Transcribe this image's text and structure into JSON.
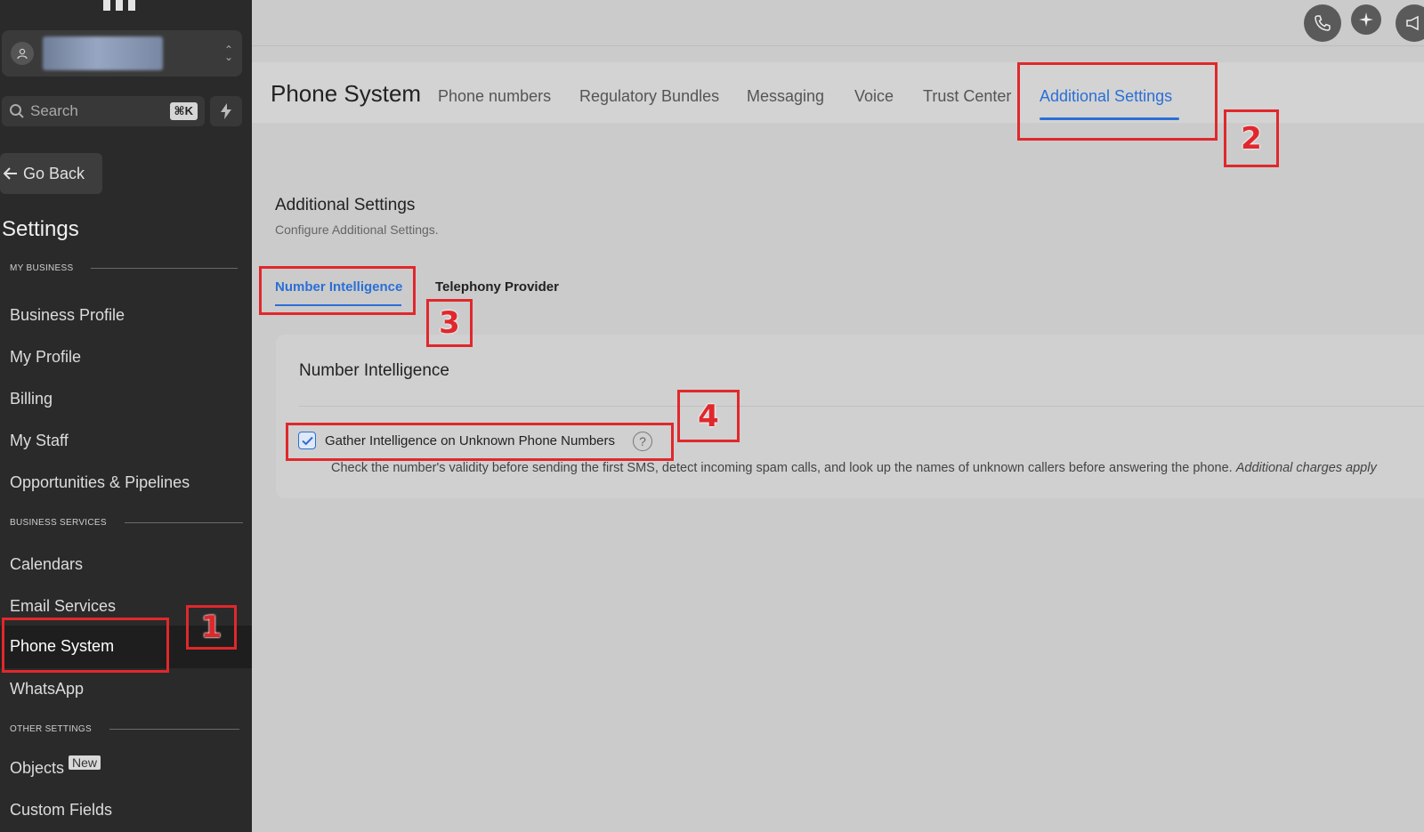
{
  "sidebar": {
    "account_icon": "user-circle-icon",
    "search": {
      "placeholder": "Search",
      "shortcut": "⌘K"
    },
    "go_back_label": "Go Back",
    "settings_heading": "Settings",
    "sections": {
      "my_business": "MY BUSINESS",
      "business_services": "BUSINESS SERVICES",
      "other_settings": "OTHER SETTINGS"
    },
    "items": {
      "business_profile": "Business Profile",
      "my_profile": "My Profile",
      "billing": "Billing",
      "my_staff": "My Staff",
      "opportunities": "Opportunities & Pipelines",
      "calendars": "Calendars",
      "email_services": "Email Services",
      "phone_system": "Phone System",
      "whatsapp": "WhatsApp",
      "objects": "Objects",
      "objects_badge": "New",
      "custom_fields": "Custom Fields"
    }
  },
  "topbar": {
    "icons": [
      "phone-icon",
      "sparkle-icon",
      "megaphone-icon"
    ]
  },
  "header": {
    "title": "Phone System",
    "tabs": [
      {
        "label": "Phone numbers"
      },
      {
        "label": "Regulatory Bundles"
      },
      {
        "label": "Messaging"
      },
      {
        "label": "Voice"
      },
      {
        "label": "Trust Center"
      },
      {
        "label": "Additional Settings",
        "active": true
      }
    ]
  },
  "content": {
    "title": "Additional Settings",
    "subtitle": "Configure Additional Settings.",
    "sub_tabs": [
      {
        "label": "Number Intelligence",
        "active": true
      },
      {
        "label": "Telephony Provider"
      }
    ],
    "card": {
      "title": "Number Intelligence",
      "checkbox_label": "Gather Intelligence on Unknown Phone Numbers",
      "checkbox_checked": true,
      "description": "Check the number's validity before sending the first SMS, detect incoming spam calls, and look up the names of unknown callers before answering the phone.",
      "description_note": "Additional charges apply"
    }
  },
  "annotations": {
    "n1": "1",
    "n2": "2",
    "n3": "3",
    "n4": "4"
  },
  "colors": {
    "accent": "#2b6fd6",
    "annotation": "#e0282c",
    "sidebar": "#2a2a2a"
  }
}
